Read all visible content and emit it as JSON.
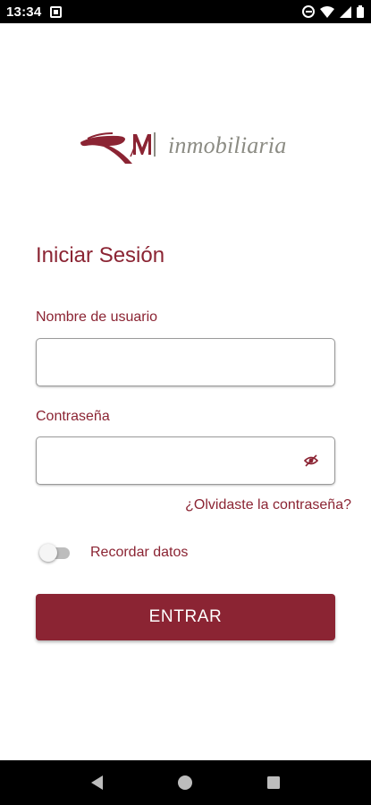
{
  "status_bar": {
    "time": "13:34",
    "icons": [
      "notification-icon",
      "do-not-disturb-icon",
      "wifi-icon",
      "signal-icon",
      "battery-icon"
    ]
  },
  "logo": {
    "mark_text": "RM",
    "text": "inmobiliaria",
    "colors": {
      "mark": "#8b2433",
      "text": "#8c8c84"
    }
  },
  "login": {
    "title": "Iniciar Sesión",
    "username_label": "Nombre de usuario",
    "username_value": "",
    "password_label": "Contraseña",
    "password_value": "",
    "password_toggle_icon": "eye-off-icon",
    "forgot_password": "¿Olvidaste la contraseña?",
    "remember_label": "Recordar datos",
    "remember_on": false,
    "submit_label": "ENTRAR"
  },
  "nav_bar": {
    "buttons": [
      "back-icon",
      "home-icon",
      "recents-icon"
    ]
  },
  "theme": {
    "accent": "#8b2433",
    "status_bar_bg": "#000000",
    "background": "#ffffff"
  }
}
